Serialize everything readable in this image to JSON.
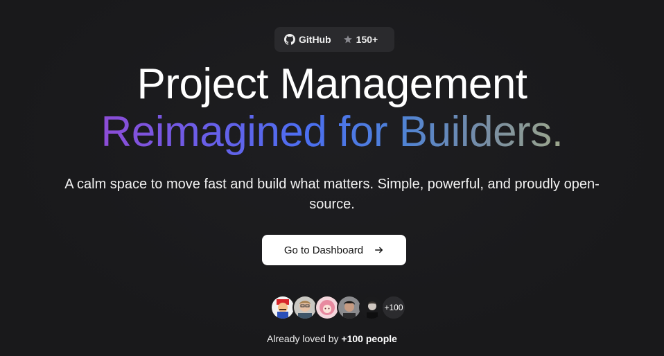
{
  "badge": {
    "github_label": "GitHub",
    "stars": "150+",
    "icons": [
      "github-icon",
      "star-icon"
    ]
  },
  "hero": {
    "title_line1": "Project Management",
    "title_line2": "Reimagined for Builders.",
    "subtitle": "A calm space to move fast and build what matters. Simple, powerful, and proudly open-source.",
    "gradient_colors": [
      "#8d4cd6",
      "#6a5ee8",
      "#4b6ff0",
      "#4f83d6",
      "#7b8fa0",
      "#9ea88c"
    ]
  },
  "cta": {
    "label": "Go to Dashboard",
    "icon": "arrow-right-icon"
  },
  "social_proof": {
    "avatar_count_label": "+100",
    "loved_prefix": "Already loved by",
    "loved_count": "+100 people"
  },
  "colors": {
    "background": "#1a1a1c",
    "pill_background": "#2a2a2d",
    "button_background": "#ffffff"
  }
}
